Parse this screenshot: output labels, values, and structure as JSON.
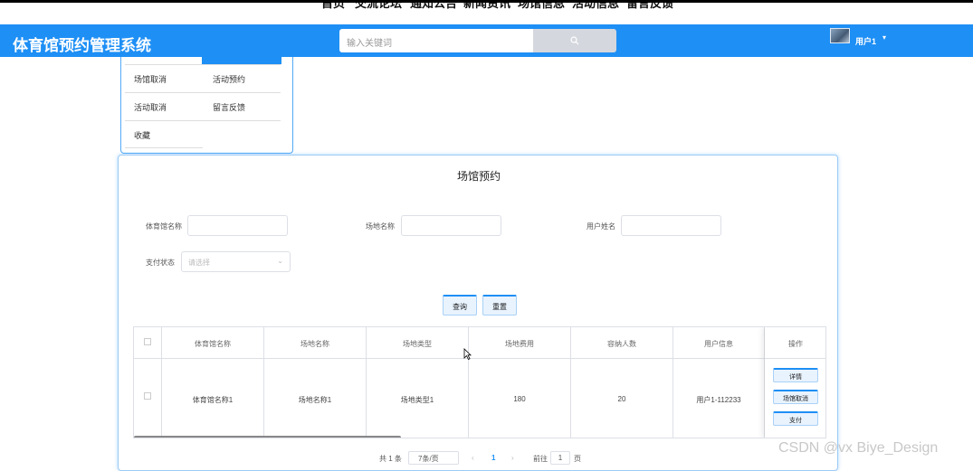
{
  "topnav": {
    "items": [
      "首页",
      "交流论坛",
      "通知公告",
      "新闻资讯",
      "场馆信息",
      "活动信息",
      "留言反馈"
    ]
  },
  "header": {
    "brand": "体育馆预约管理系统",
    "search_placeholder": "输入关键词",
    "user_name": "用户1",
    "caret": "▾"
  },
  "side_menu": {
    "items": [
      "场馆取消",
      "活动预约",
      "活动取消",
      "留言反馈",
      "收藏"
    ]
  },
  "main": {
    "title": "场馆预约",
    "filters": {
      "gym_name_label": "体育馆名称",
      "venue_name_label": "场地名称",
      "user_name_label": "用户姓名",
      "pay_status_label": "支付状态",
      "pay_status_placeholder": "请选择"
    },
    "buttons": {
      "query": "查询",
      "reset": "重置"
    },
    "table": {
      "columns": [
        "体育馆名称",
        "场地名称",
        "场地类型",
        "场地费用",
        "容纳人数",
        "用户信息",
        "操作"
      ],
      "rows": [
        {
          "gym_name": "体育馆名称1",
          "venue_name": "场地名称1",
          "venue_type": "场地类型1",
          "fee": "180",
          "capacity": "20",
          "user_info": "用户1-112233",
          "actions": [
            "详情",
            "场馆取消",
            "支付"
          ]
        }
      ]
    },
    "pagination": {
      "total": "共 1 条",
      "page_size": "7条/页",
      "prev": "‹",
      "current_page": "1",
      "next": "›",
      "goto_label": "前往",
      "goto_value": "1",
      "page_unit": "页"
    }
  },
  "watermark": "CSDN @vx Biye_Design",
  "colors": {
    "primary": "#1e8ff5",
    "button_bg": "#e8f3fe"
  }
}
